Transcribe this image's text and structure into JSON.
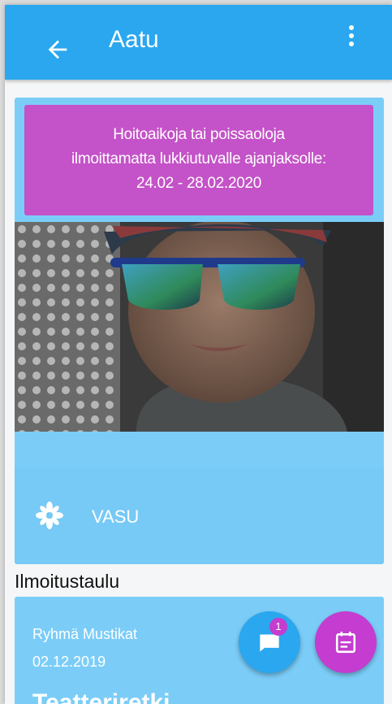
{
  "appbar": {
    "title": "Aatu",
    "back_icon": "arrow-left-icon",
    "menu_icon": "more-vert-icon",
    "color": "#2aa7ef"
  },
  "notice": {
    "line1": "Hoitoaikoja tai poissaoloja",
    "line2": "ilmoittamatta lukkiutuvalle ajanjaksolle:",
    "line3": "24.02 - 28.02.2020",
    "color": "#c452c8"
  },
  "vasu": {
    "label": "VASU",
    "icon": "flower-icon"
  },
  "board": {
    "heading": "Ilmoitustaulu",
    "post": {
      "group": "Ryhmä Mustikat",
      "date": "02.12.2019",
      "title": "Teatteriretki"
    }
  },
  "fabs": {
    "chat_icon": "chat-icon",
    "chat_badge": "1",
    "calendar_icon": "calendar-icon"
  }
}
